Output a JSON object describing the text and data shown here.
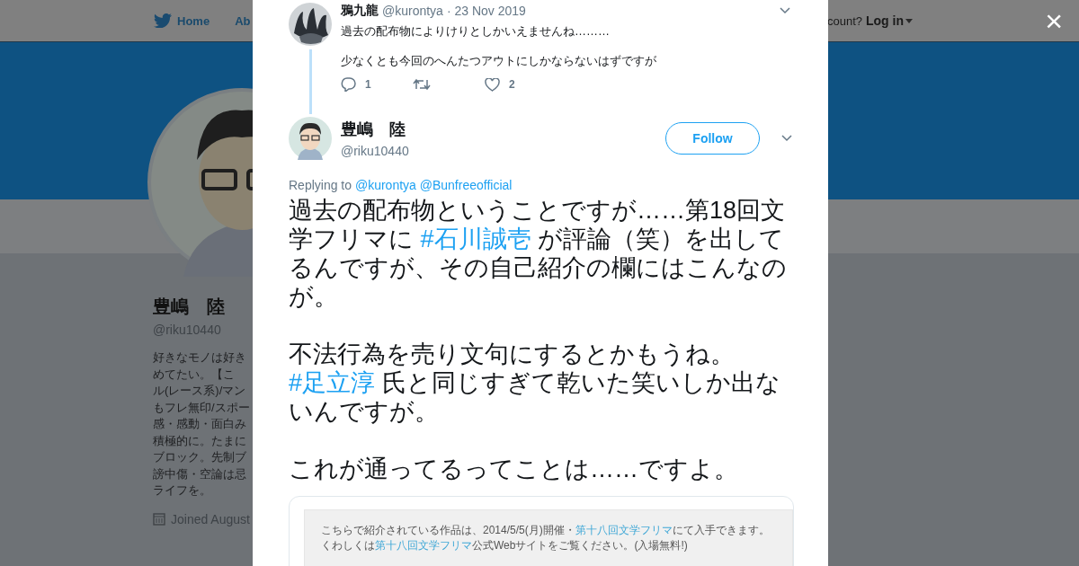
{
  "background_page": {
    "nav": [
      {
        "label": "Home",
        "kind": "home"
      },
      {
        "label": "Ab",
        "kind": "plain"
      }
    ],
    "account_prompt": "count?",
    "login": "Log in",
    "profile": {
      "name": "豊嶋　陸",
      "handle": "@riku10440",
      "bio_lines": [
        "好きなモノは好き",
        "めてたい。【こ",
        "ル(レース系)/マン",
        "もフレ無印/スポー",
        "感・感動・面白み",
        "積極的に。たまに",
        "ブロック。先制ブ",
        "謗中傷・空論は忌",
        "ライフを。"
      ],
      "joined": "Joined August"
    }
  },
  "modal": {
    "close_label": "×",
    "parent_tweet": {
      "name": "鴉九龍",
      "handle": "@kurontya",
      "date": "· 23 Nov 2019",
      "lines": [
        "過去の配布物によりけりとしかいえませんね………",
        "少なくとも今回のへんたつアウトにしかならないはずですが"
      ],
      "replies": "1",
      "likes": "2"
    },
    "tweet": {
      "name": "豊嶋　陸",
      "handle": "@riku10440",
      "follow": "Follow",
      "replying_label": "Replying to",
      "replying_to": [
        "@kurontya",
        "@Bunfreeofficial"
      ],
      "paragraphs": [
        [
          {
            "kind": "text",
            "text": "過去の配布物ということですが……第18回文学フリマに "
          },
          {
            "kind": "hashtag",
            "text": "#石川誠壱"
          },
          {
            "kind": "text",
            "text": " が評論（笑）を出してるんですが、その自己紹介の欄にはこんなのが。"
          }
        ],
        [
          {
            "kind": "text",
            "text": "不法行為を売り文句にするとかもうね。 "
          },
          {
            "kind": "hashtag",
            "text": "#足立淳"
          },
          {
            "kind": "text",
            "text": " 氏と同じすぎて乾いた笑いしか出ないんですが。"
          }
        ],
        [
          {
            "kind": "text",
            "text": "これが通ってるってことは……ですよ。"
          }
        ]
      ],
      "card_lines": [
        [
          {
            "kind": "text",
            "text": "こちらで紹介されている作品は、2014/5/5(月)開催・"
          },
          {
            "kind": "link",
            "text": "第十八回文学フリマ"
          },
          {
            "kind": "text",
            "text": "にて入手できます。"
          }
        ],
        [
          {
            "kind": "text",
            "text": "くわしくは"
          },
          {
            "kind": "link",
            "text": "第十八回文学フリマ"
          },
          {
            "kind": "text",
            "text": "公式Webサイトをご覧ください。(入場無料!)"
          }
        ]
      ]
    }
  }
}
